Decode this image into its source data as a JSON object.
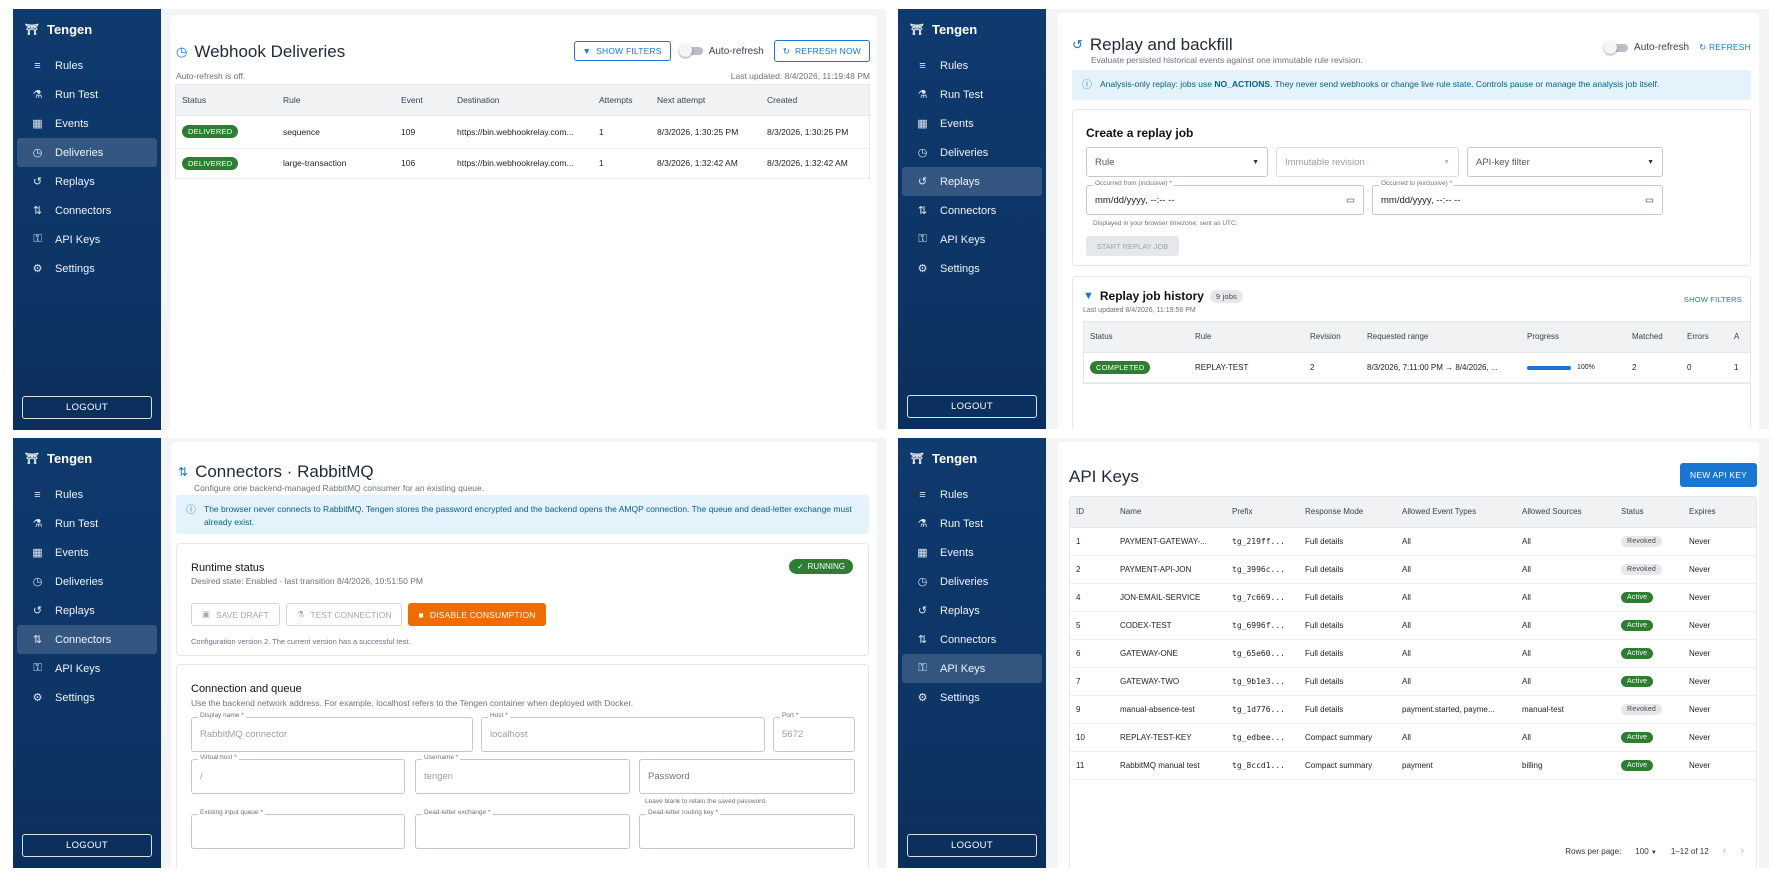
{
  "brand": "Tengen",
  "logout": "LOGOUT",
  "nav": {
    "rules": "Rules",
    "run_test": "Run Test",
    "events": "Events",
    "deliveries": "Deliveries",
    "replays": "Replays",
    "connectors": "Connectors",
    "api_keys": "API Keys",
    "settings": "Settings"
  },
  "colors": {
    "sidebar": "#0f3a6e",
    "accent": "#1976d2",
    "success": "#2e7d32",
    "warning": "#ef6c00",
    "info_bg": "#e3f2fb"
  },
  "deliveries": {
    "title": "Webhook Deliveries",
    "show_filters": "SHOW FILTERS",
    "auto_refresh": "Auto-refresh",
    "refresh_now": "REFRESH NOW",
    "auto_off": "Auto-refresh is off.",
    "last_updated": "Last updated: 8/4/2026, 11:19:48 PM",
    "columns": [
      "Status",
      "Rule",
      "Event",
      "Destination",
      "Attempts",
      "Next attempt",
      "Created"
    ],
    "rows": [
      {
        "status": "DELIVERED",
        "rule": "sequence",
        "event": "109",
        "destination": "https://bin.webhookrelay.com...",
        "attempts": "1",
        "next": "8/3/2026, 1:30:25 PM",
        "created": "8/3/2026, 1:30:25 PM"
      },
      {
        "status": "DELIVERED",
        "rule": "large-transaction",
        "event": "106",
        "destination": "https://bin.webhookrelay.com...",
        "attempts": "1",
        "next": "8/3/2026, 1:32:42 AM",
        "created": "8/3/2026, 1:32:42 AM"
      }
    ]
  },
  "replays": {
    "title": "Replay and backfill",
    "subtitle": "Evaluate persisted historical events against one immutable rule revision.",
    "auto_refresh": "Auto-refresh",
    "refresh": "REFRESH",
    "info_pre": "Analysis-only replay: jobs use ",
    "info_bold": "NO_ACTIONS",
    "info_post": ". They never send webhooks or change live rule state. Controls pause or manage the analysis job itself.",
    "create_title": "Create a replay job",
    "rule_ph": "Rule",
    "revision_ph": "Immutable revision",
    "apikey_ph": "API-key filter",
    "from_label": "Occurred from (inclusive) *",
    "to_label": "Occurred to (exclusive) *",
    "date_ph": "mm/dd/yyyy, --:-- --",
    "tz_hint": "Displayed in your browser timezone; sent as UTC.",
    "start": "START REPLAY JOB",
    "history_title": "Replay job history",
    "jobs_count": "9 jobs",
    "show_filters": "SHOW FILTERS",
    "history_updated": "Last updated 8/4/2026, 11:19:56 PM",
    "columns": [
      "Status",
      "Rule",
      "Revision",
      "Requested range",
      "Progress",
      "Matched",
      "Errors",
      "A"
    ],
    "rows": [
      {
        "status": "COMPLETED",
        "rule": "REPLAY-TEST",
        "revision": "2",
        "range": "8/3/2026, 7:11:00 PM → 8/4/2026, ...",
        "progress": 1.0,
        "progress_label": "100%",
        "matched": "2",
        "errors": "0",
        "a": "1"
      }
    ]
  },
  "connectors": {
    "title": "Connectors · RabbitMQ",
    "subtitle": "Configure one backend-managed RabbitMQ consumer for an existing queue.",
    "info": "The browser never connects to RabbitMQ. Tengen stores the password encrypted and the backend opens the AMQP connection. The queue and dead-letter exchange must already exist.",
    "runtime_title": "Runtime status",
    "runtime_desc": "Desired state: Enabled · last transition 8/4/2026, 10:51:50 PM",
    "running": "RUNNING",
    "save_draft": "SAVE DRAFT",
    "test_connection": "TEST CONNECTION",
    "disable": "DISABLE CONSUMPTION",
    "config_note": "Configuration version 2. The current version has a successful test.",
    "conn_title": "Connection and queue",
    "conn_desc": "Use the backend network address. For example, localhost refers to the Tengen container when deployed with Docker.",
    "display_name_label": "Display name *",
    "display_name": "RabbitMQ connector",
    "host_label": "Host *",
    "host": "localhost",
    "port_label": "Port *",
    "port": "5672",
    "vhost_label": "Virtual host *",
    "vhost": "/",
    "username_label": "Username *",
    "username": "tengen",
    "password_ph": "Password",
    "password_hint": "Leave blank to retain the saved password.",
    "queue_label": "Existing input queue *",
    "dlx_label": "Dead-letter exchange *",
    "dlrk_label": "Dead-letter routing key *"
  },
  "apikeys": {
    "title": "API Keys",
    "new_key": "NEW API KEY",
    "columns": [
      "ID",
      "Name",
      "Prefix",
      "Response Mode",
      "Allowed Event Types",
      "Allowed Sources",
      "Status",
      "Expires"
    ],
    "rows": [
      {
        "id": "1",
        "name": "PAYMENT-GATEWAY-...",
        "prefix": "tg_219ff...",
        "mode": "Full details",
        "types": "All",
        "sources": "All",
        "status": "Revoked",
        "expires": "Never"
      },
      {
        "id": "2",
        "name": "PAYMENT-API-JON",
        "prefix": "tg_3996c...",
        "mode": "Full details",
        "types": "All",
        "sources": "All",
        "status": "Revoked",
        "expires": "Never"
      },
      {
        "id": "4",
        "name": "JON-EMAIL-SERVICE",
        "prefix": "tg_7c669...",
        "mode": "Full details",
        "types": "All",
        "sources": "All",
        "status": "Active",
        "expires": "Never"
      },
      {
        "id": "5",
        "name": "CODEX-TEST",
        "prefix": "tg_6996f...",
        "mode": "Full details",
        "types": "All",
        "sources": "All",
        "status": "Active",
        "expires": "Never"
      },
      {
        "id": "6",
        "name": "GATEWAY-ONE",
        "prefix": "tg_65e60...",
        "mode": "Full details",
        "types": "All",
        "sources": "All",
        "status": "Active",
        "expires": "Never"
      },
      {
        "id": "7",
        "name": "GATEWAY-TWO",
        "prefix": "tg_9b1e3...",
        "mode": "Full details",
        "types": "All",
        "sources": "All",
        "status": "Active",
        "expires": "Never"
      },
      {
        "id": "9",
        "name": "manual-absence-test",
        "prefix": "tg_1d776...",
        "mode": "Full details",
        "types": "payment.started, payme...",
        "sources": "manual-test",
        "status": "Revoked",
        "expires": "Never"
      },
      {
        "id": "10",
        "name": "REPLAY-TEST-KEY",
        "prefix": "tg_edbee...",
        "mode": "Compact summary",
        "types": "All",
        "sources": "All",
        "status": "Active",
        "expires": "Never"
      },
      {
        "id": "11",
        "name": "RabbitMQ manual test",
        "prefix": "tg_8ccd1...",
        "mode": "Compact summary",
        "types": "payment",
        "sources": "billing",
        "status": "Active",
        "expires": "Never"
      }
    ],
    "rows_per_page_label": "Rows per page:",
    "rows_per_page": "100",
    "range": "1–12 of 12"
  }
}
